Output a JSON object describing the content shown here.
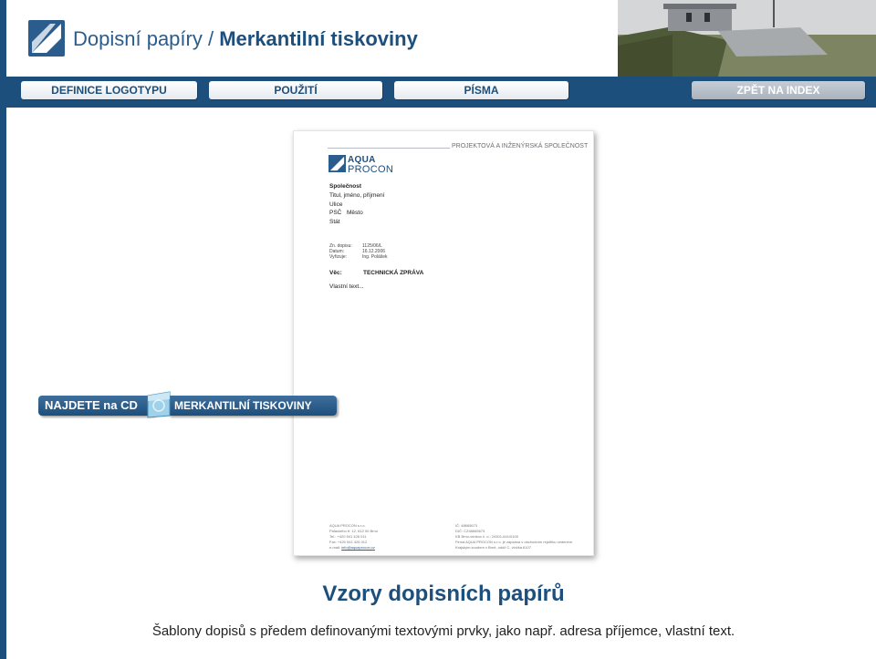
{
  "header": {
    "title_prefix": "Dopisní papíry / ",
    "title_bold": "Merkantilní tiskoviny"
  },
  "nav": {
    "items": [
      {
        "label": "DEFINICE LOGOTYPU"
      },
      {
        "label": "POUŽITÍ"
      },
      {
        "label": "PÍSMA"
      }
    ],
    "back_label": "ZPĚT NA INDEX"
  },
  "letter": {
    "tagline": "PROJEKTOVÁ A INŽENÝRSKÁ SPOLEČNOST",
    "logo_line1": "AQUA",
    "logo_line2": "PROCON",
    "recipient": {
      "company": "Společnost",
      "name": "Titul, jméno, příjmení",
      "street": "Ulice",
      "psc": "PSČ",
      "city": "Město",
      "state": "Stát"
    },
    "meta": [
      {
        "label": "Zn. dopisu:",
        "value": "1125/06/L"
      },
      {
        "label": "Datum:",
        "value": "16.12.2006"
      },
      {
        "label": "Vyřizuje:",
        "value": "Ing. Polášek"
      }
    ],
    "subject_label": "Věc:",
    "subject_value": "TECHNICKÁ ZPRÁVA",
    "body": "Vlastní text...",
    "footer_left": [
      "AQUA PROCON s.r.o.",
      "Palackého tř. 12, 612 00  Brno",
      "Tel.: +420 541 426 011",
      "Fax: +420 541 426 012"
    ],
    "footer_email_label": "e-mail: ",
    "footer_email": "info@aquaprocon.cz",
    "footer_right": [
      "IČ: 48665673",
      "DIČ: CZ48665673",
      "KB Brno-venkov č. ú.: 24301-641/0100",
      "Firma AQUA PROCON s.r.o. je zapsána v obchodním rejstříku vedeném",
      "Krajským soudem v Brně, oddíl C, vložka 6107"
    ]
  },
  "cd_banner": {
    "left": "NAJDETE na CD",
    "right": "MERKANTILNÍ TISKOVINY"
  },
  "main": {
    "heading": "Vzory dopisních papírů",
    "subheading": "Šablony dopisů s předem definovanými textovými prvky, jako např. adresa příjemce, vlastní text."
  },
  "colors": {
    "brand_navy": "#1d4f7c",
    "brand_blue": "#2a5c8e"
  }
}
